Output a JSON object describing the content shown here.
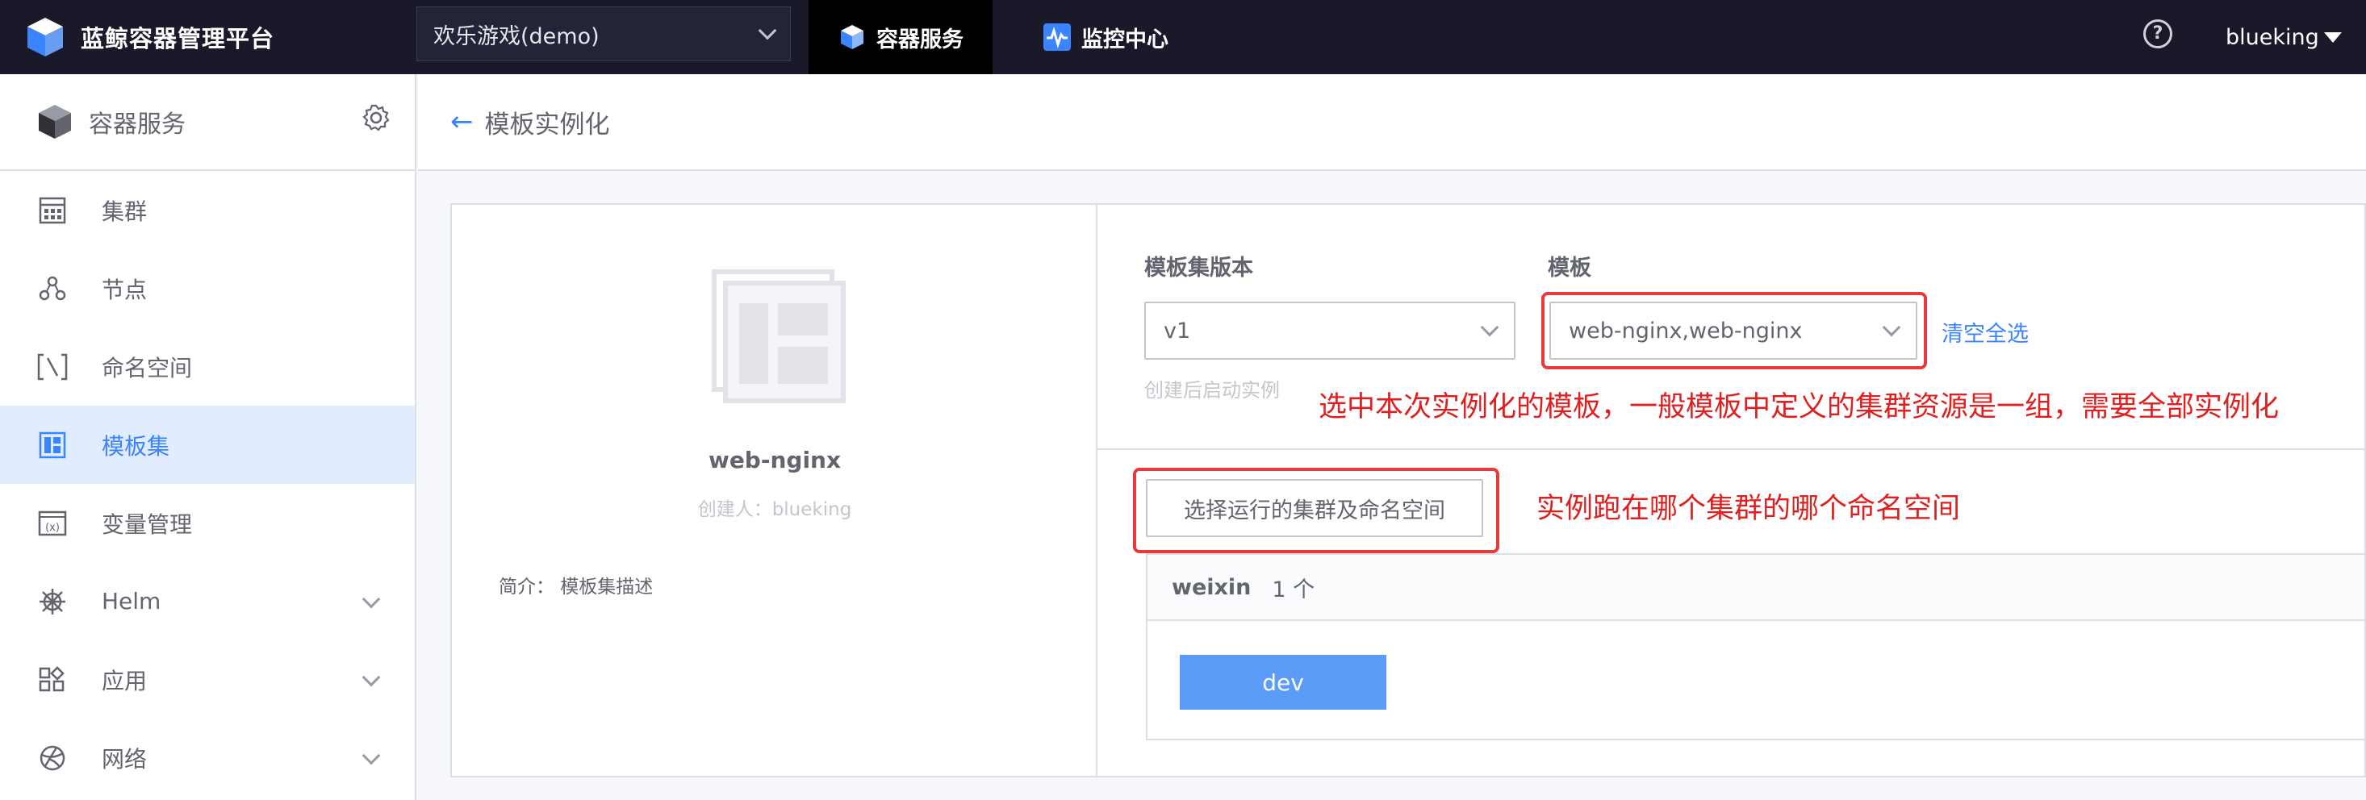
{
  "topbar": {
    "brand": "蓝鲸容器管理平台",
    "project": "欢乐游戏(demo)",
    "tabs": [
      "容器服务",
      "监控中心"
    ],
    "help": "?",
    "user": "blueking"
  },
  "sidebar": {
    "title": "容器服务",
    "items": [
      {
        "label": "集群",
        "icon": "cluster-icon"
      },
      {
        "label": "节点",
        "icon": "node-icon"
      },
      {
        "label": "命名空间",
        "icon": "namespace-icon"
      },
      {
        "label": "模板集",
        "icon": "template-icon",
        "active": true
      },
      {
        "label": "变量管理",
        "icon": "variable-icon"
      },
      {
        "label": "Helm",
        "icon": "helm-icon",
        "expandable": true
      },
      {
        "label": "应用",
        "icon": "app-icon",
        "expandable": true
      },
      {
        "label": "网络",
        "icon": "network-icon",
        "expandable": true
      }
    ]
  },
  "header": {
    "back": "←",
    "title": "模板实例化"
  },
  "template": {
    "name": "web-nginx",
    "creator": "创建人：blueking",
    "desc": "简介：  模板集描述"
  },
  "form": {
    "version_label": "模板集版本",
    "version_value": "v1",
    "version_hint": "创建后启动实例",
    "template_label": "模板",
    "template_value": "web-nginx,web-nginx",
    "clear_all": "清空全选",
    "select_button": "选择运行的集群及命名空间"
  },
  "annotations": {
    "template_note": "选中本次实例化的模板，一般模板中定义的集群资源是一组，需要全部实例化",
    "cluster_note": "实例跑在哪个集群的哪个命名空间"
  },
  "cluster": {
    "name": "weixin",
    "count": "1 个",
    "namespace": "dev"
  },
  "colors": {
    "accent": "#3a84ff",
    "annotation": "#e02020",
    "topbar": "#191929"
  }
}
